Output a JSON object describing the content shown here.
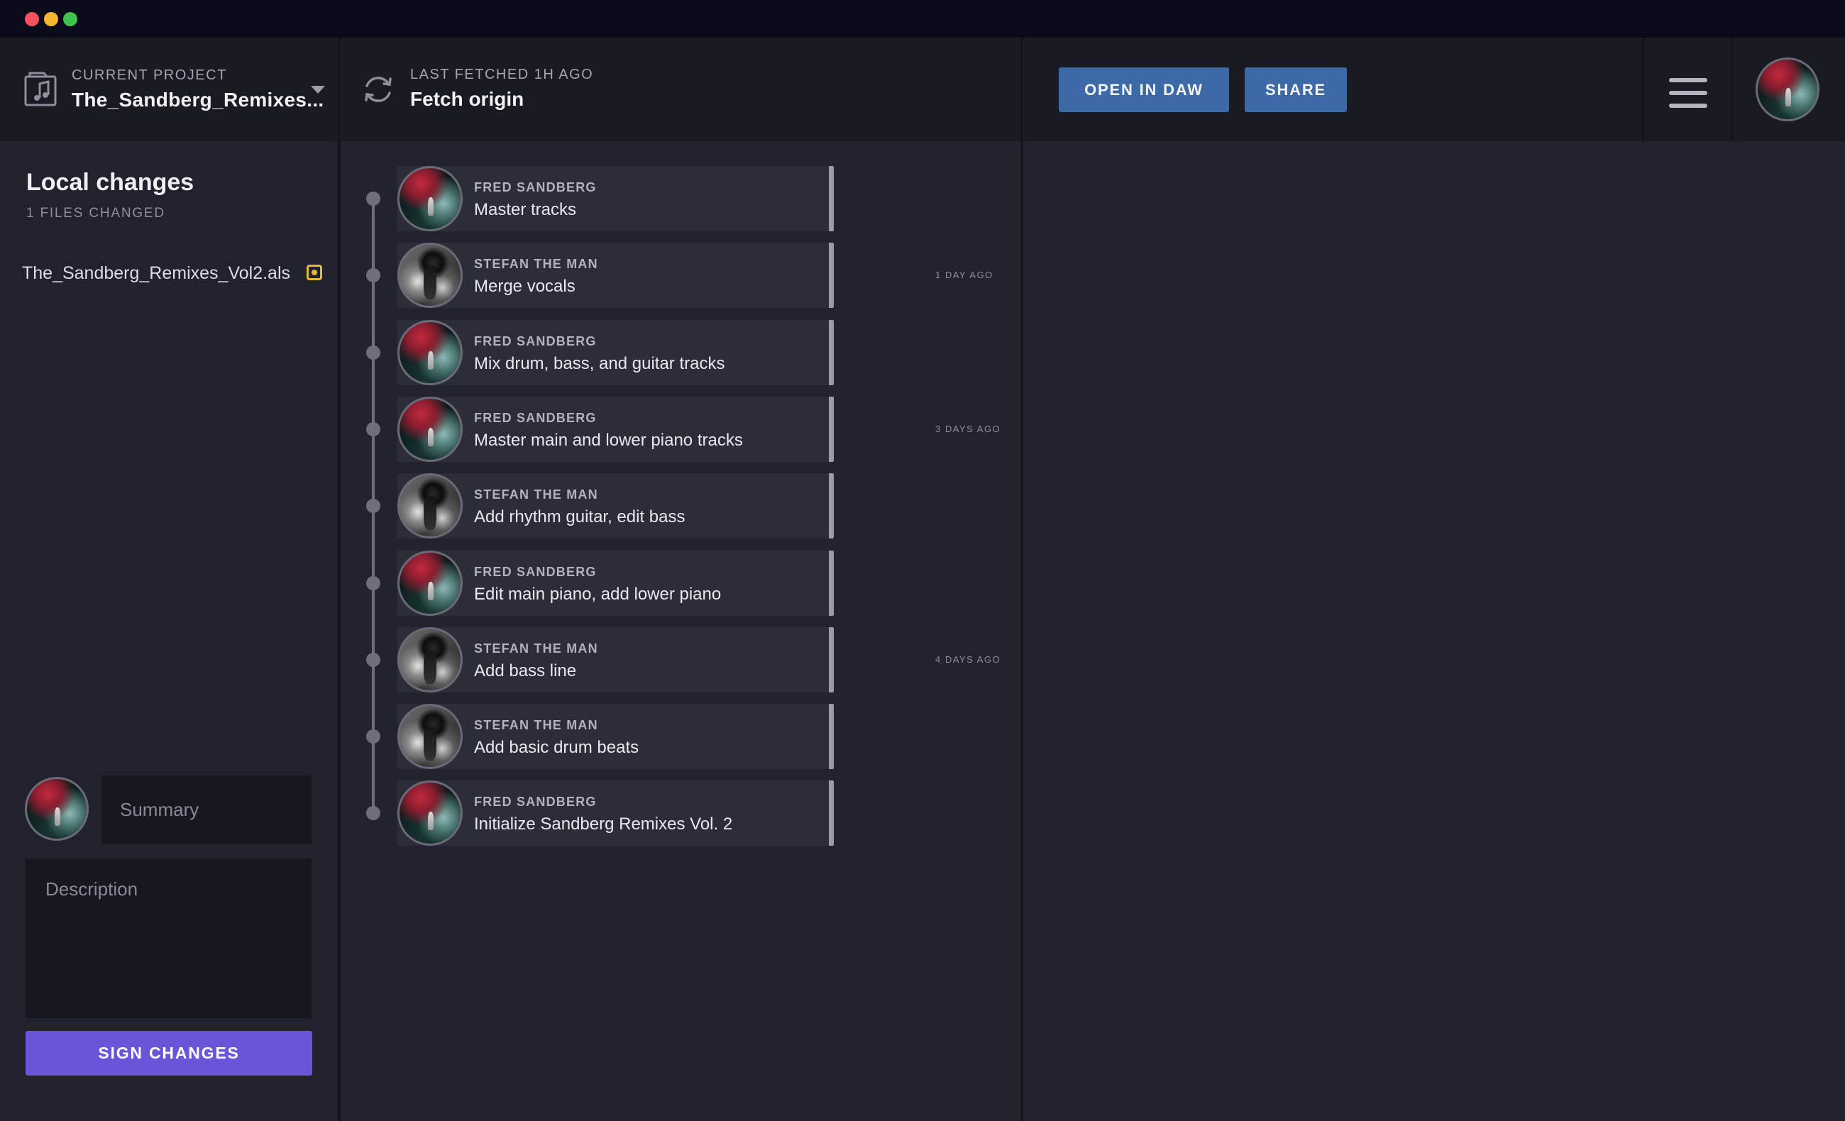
{
  "header": {
    "project_label": "CURRENT PROJECT",
    "project_name": "The_Sandberg_Remixes...",
    "fetch_label": "LAST FETCHED 1H AGO",
    "fetch_title": "Fetch origin",
    "open_daw_label": "OPEN IN DAW",
    "share_label": "SHARE"
  },
  "sidebar": {
    "title": "Local changes",
    "subtitle": "1 FILES CHANGED",
    "files": [
      {
        "name": "The_Sandberg_Remixes_Vol2.als",
        "status_icon": "modified-icon"
      }
    ],
    "summary_placeholder": "Summary",
    "description_placeholder": "Description",
    "sign_label": "SIGN CHANGES"
  },
  "commits": [
    {
      "author": "FRED SANDBERG",
      "message": "Master tracks",
      "avatar": "fred"
    },
    {
      "author": "STEFAN THE MAN",
      "message": "Merge vocals",
      "avatar": "stefan"
    },
    {
      "author": "FRED SANDBERG",
      "message": "Mix drum, bass, and guitar tracks",
      "avatar": "fred"
    },
    {
      "author": "FRED SANDBERG",
      "message": "Master main and lower piano tracks",
      "avatar": "fred"
    },
    {
      "author": "STEFAN THE MAN",
      "message": "Add rhythm guitar, edit bass",
      "avatar": "stefan"
    },
    {
      "author": "FRED SANDBERG",
      "message": "Edit main piano, add lower piano",
      "avatar": "fred"
    },
    {
      "author": "STEFAN THE MAN",
      "message": "Add bass line",
      "avatar": "stefan"
    },
    {
      "author": "STEFAN THE MAN",
      "message": "Add basic drum beats",
      "avatar": "stefan"
    },
    {
      "author": "FRED SANDBERG",
      "message": "Initialize Sandberg Remixes Vol. 2",
      "avatar": "fred"
    }
  ],
  "time_labels": [
    "1 DAY AGO",
    "3 DAYS AGO",
    "4 DAYS AGO"
  ],
  "colors": {
    "accent_blue": "#3c6aa6",
    "accent_purple": "#6a55d8",
    "modified_yellow": "#e9b43a",
    "traffic_red": "#f4525f",
    "traffic_yellow": "#f5b82e",
    "traffic_green": "#3ec44d"
  }
}
